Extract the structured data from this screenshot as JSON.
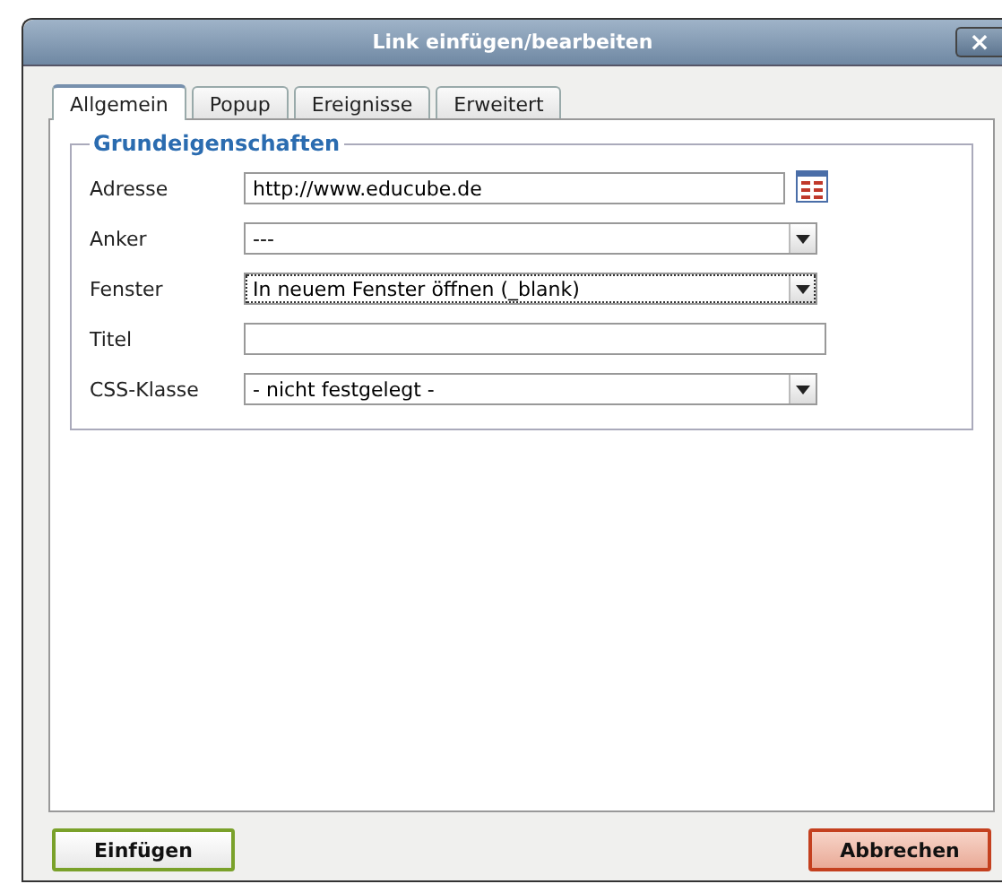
{
  "window": {
    "title": "Link einfügen/bearbeiten",
    "close": "×"
  },
  "tabs": [
    {
      "label": "Allgemein",
      "selected": true
    },
    {
      "label": "Popup",
      "selected": false
    },
    {
      "label": "Ereignisse",
      "selected": false
    },
    {
      "label": "Erweitert",
      "selected": false
    }
  ],
  "fieldset": {
    "legend": "Grundeigenschaften",
    "fields": [
      {
        "kind": "text",
        "label": "Adresse",
        "value": "http://www.educube.de",
        "browse": true,
        "focused": false
      },
      {
        "kind": "select",
        "label": "Anker",
        "value": "---",
        "focused": false
      },
      {
        "kind": "select",
        "label": "Fenster",
        "value": "In neuem Fenster öffnen (_blank)",
        "focused": true
      },
      {
        "kind": "text",
        "label": "Titel",
        "browse": false,
        "focused": false
      },
      {
        "kind": "select",
        "label": "CSS-Klasse",
        "value": "- nicht festgelegt -",
        "focused": false
      }
    ]
  },
  "buttons": [
    {
      "label": "Einfügen",
      "kind": "primary"
    },
    {
      "label": "Abbrechen",
      "kind": "cancel"
    }
  ]
}
